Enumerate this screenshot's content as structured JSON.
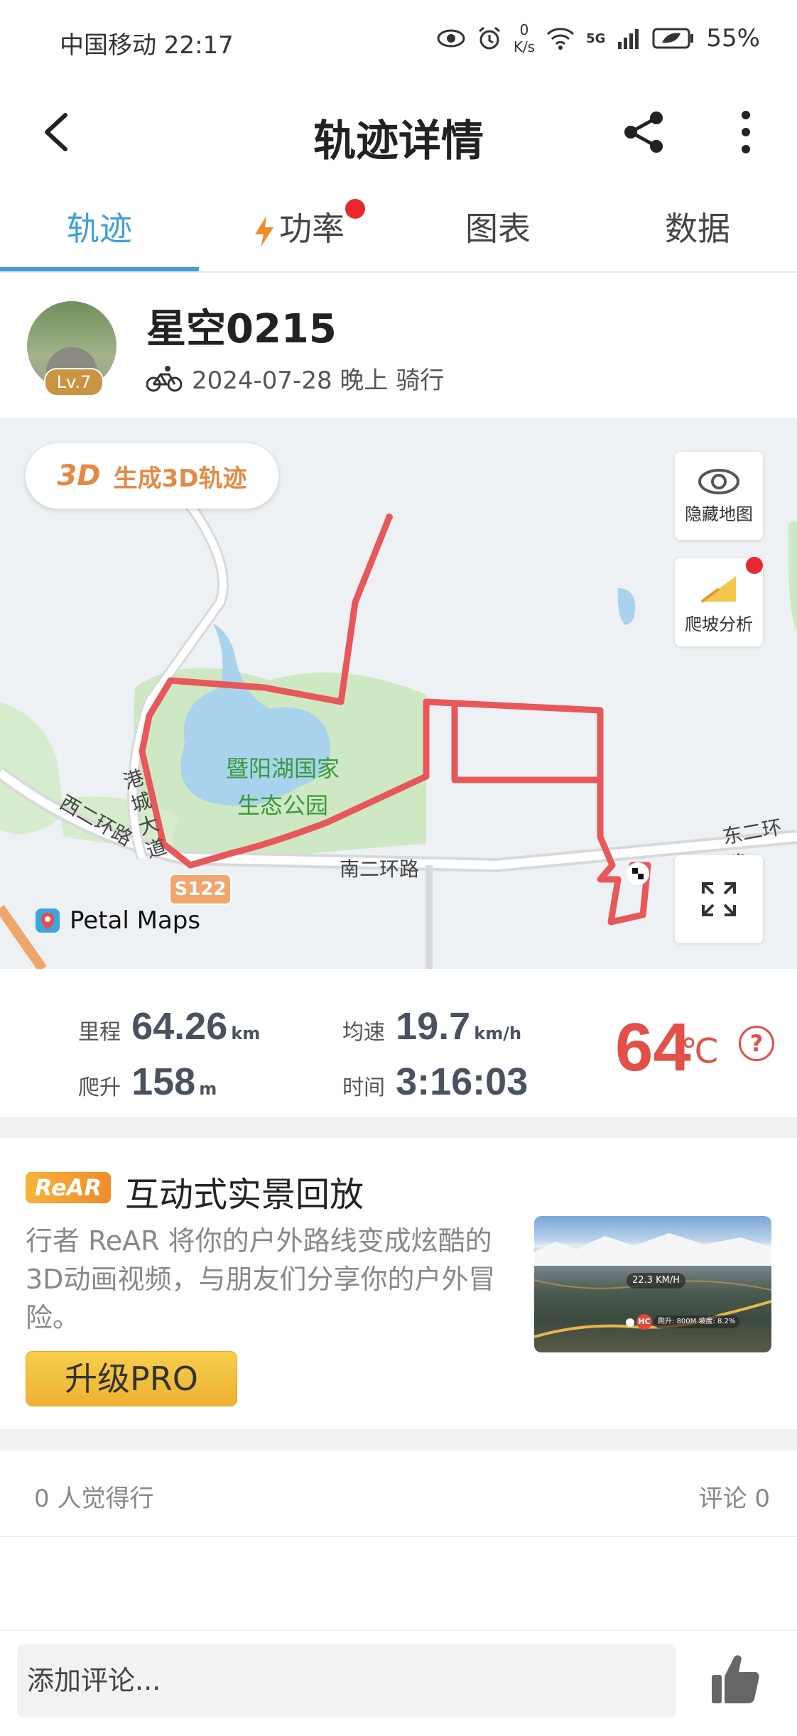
{
  "status_bar": {
    "carrier_time": "中国移动 22:17",
    "net_speed_value": "0",
    "net_speed_unit": "K/s",
    "network": "5G",
    "battery": "55%"
  },
  "header": {
    "title": "轨迹详情"
  },
  "tabs": [
    {
      "label": "轨迹",
      "active": true
    },
    {
      "label": "功率",
      "badge": true
    },
    {
      "label": "图表"
    },
    {
      "label": "数据"
    }
  ],
  "profile": {
    "name": "星空0215",
    "level": "Lv.7",
    "date_time": "2024-07-28 晚上 骑行"
  },
  "map": {
    "btn_3d_logo": "3D",
    "btn_3d_label": "生成3D轨迹",
    "hide_map": "隐藏地图",
    "climb_analysis": "爬坡分析",
    "park_name_line1": "暨阳湖国家",
    "park_name_line2": "生态公园",
    "road_south": "南二环路",
    "road_west": "西二环路",
    "road_east": "东二环路",
    "road_gangcheng": "港城大道",
    "highway_badge": "S122",
    "provider": "Petal Maps"
  },
  "stats": {
    "distance_label": "里程",
    "distance_value": "64.26",
    "distance_unit": "km",
    "climb_label": "爬升",
    "climb_value": "158",
    "climb_unit": "m",
    "avg_speed_label": "均速",
    "avg_speed_value": "19.7",
    "avg_speed_unit": "km/h",
    "time_label": "时间",
    "time_value": "3:16:03",
    "temperature_value": "64",
    "temperature_unit": "℃"
  },
  "rear": {
    "badge": "ReAR",
    "title": "互动式实景回放",
    "description": "行者 ReAR 将你的户外路线变成炫酷的3D动画视频，与朋友们分享你的户外冒险。",
    "upgrade_label": "升级PRO",
    "preview_speed": "22.3 KM/H",
    "preview_marker": "HC",
    "preview_stats": "爬升: 800M 坡度: 8.2%"
  },
  "reactions": {
    "likes": "0 人觉得行",
    "comments": "评论 0"
  },
  "comment_bar": {
    "placeholder": "添加评论..."
  },
  "colors": {
    "accent_blue": "#3fa0d6",
    "track_red": "#e8575a",
    "temperature_red": "#e25049",
    "park_green": "#cfe8c4",
    "water_blue": "#a9d3ec"
  }
}
